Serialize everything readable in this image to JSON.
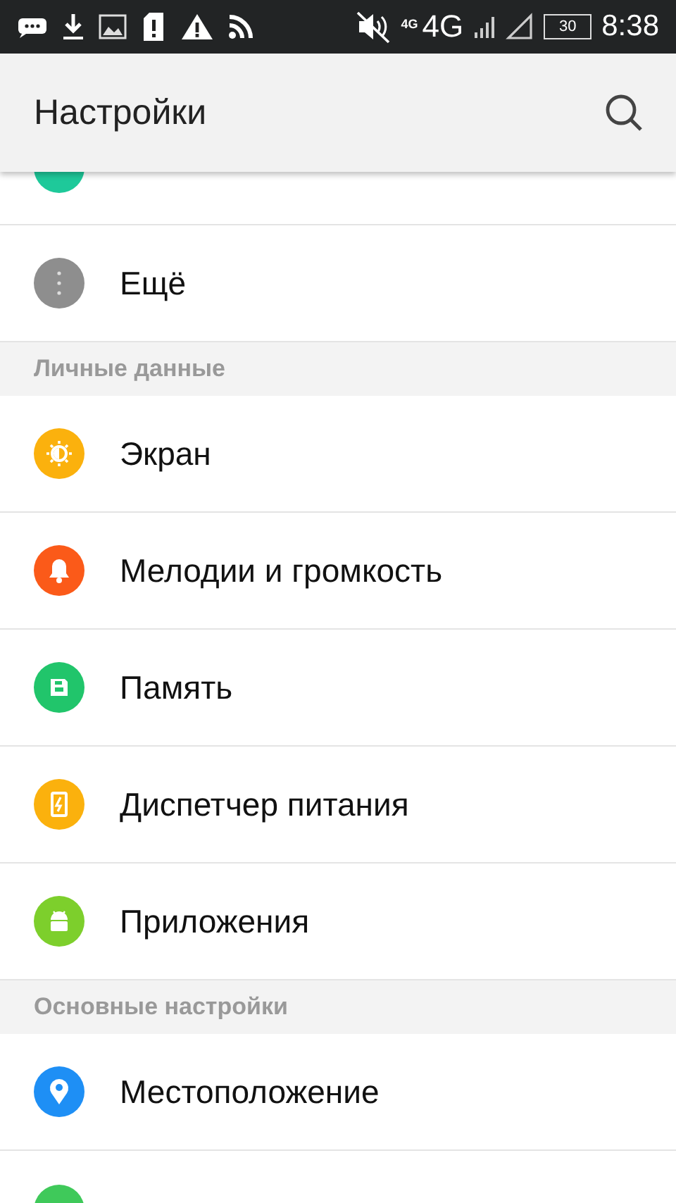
{
  "status_bar": {
    "network_small": "4G",
    "network": "4G",
    "battery": "30",
    "time": "8:38"
  },
  "app_bar": {
    "title": "Настройки"
  },
  "entries": [
    {
      "kind": "partial",
      "color": "#1ec99a"
    },
    {
      "kind": "item",
      "color": "#8e8e8e",
      "label": "Ещё"
    },
    {
      "kind": "header",
      "label": "Личные данные"
    },
    {
      "kind": "item",
      "color": "#fbb10d",
      "label": "Экран"
    },
    {
      "kind": "item",
      "color": "#fb5a19",
      "label": "Мелодии и громкость"
    },
    {
      "kind": "item",
      "color": "#21c56b",
      "label": "Память"
    },
    {
      "kind": "item",
      "color": "#fbb10d",
      "label": "Диспетчер питания"
    },
    {
      "kind": "item",
      "color": "#7dcf2c",
      "label": "Приложения"
    },
    {
      "kind": "header",
      "label": "Основные настройки"
    },
    {
      "kind": "item",
      "color": "#1e8ff5",
      "label": "Местоположение"
    },
    {
      "kind": "item",
      "color": "#3fc95a"
    }
  ]
}
